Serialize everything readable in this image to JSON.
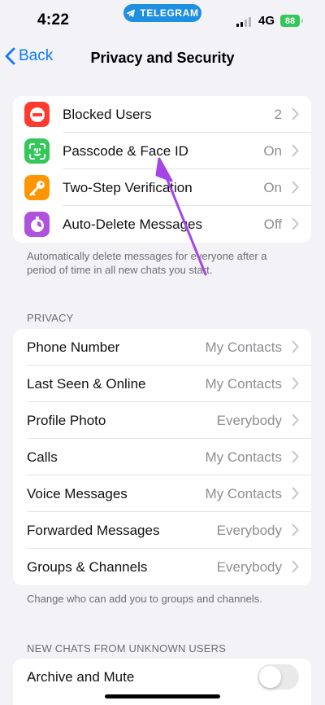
{
  "status_bar": {
    "time": "4:22",
    "app_pill": "TELEGRAM",
    "network": "4G",
    "battery": "88"
  },
  "nav": {
    "back_label": "Back",
    "title": "Privacy and Security"
  },
  "security_items": [
    {
      "label": "Blocked Users",
      "value": "2",
      "icon": "blocked-icon",
      "color": "#ff3b30"
    },
    {
      "label": "Passcode & Face ID",
      "value": "On",
      "icon": "face-id-icon",
      "color": "#34c759"
    },
    {
      "label": "Two-Step Verification",
      "value": "On",
      "icon": "key-icon",
      "color": "#ff9500"
    },
    {
      "label": "Auto-Delete Messages",
      "value": "Off",
      "icon": "timer-icon",
      "color": "#af52de"
    }
  ],
  "security_footnote": "Automatically delete messages for everyone after a period of time in all new chats you start.",
  "privacy": {
    "header": "PRIVACY",
    "items": [
      {
        "label": "Phone Number",
        "value": "My Contacts"
      },
      {
        "label": "Last Seen & Online",
        "value": "My Contacts"
      },
      {
        "label": "Profile Photo",
        "value": "Everybody"
      },
      {
        "label": "Calls",
        "value": "My Contacts"
      },
      {
        "label": "Voice Messages",
        "value": "My Contacts"
      },
      {
        "label": "Forwarded Messages",
        "value": "Everybody"
      },
      {
        "label": "Groups & Channels",
        "value": "Everybody"
      }
    ],
    "footnote": "Change who can add you to groups and channels."
  },
  "unknown_users": {
    "header": "NEW CHATS FROM UNKNOWN USERS",
    "archive_label": "Archive and Mute",
    "archive_enabled": false
  },
  "colors": {
    "accent": "#0a7aff",
    "annotation_arrow": "#a445e8"
  }
}
